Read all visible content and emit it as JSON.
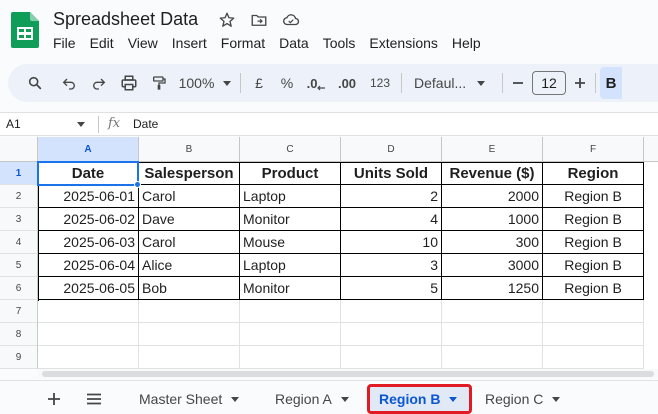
{
  "app": {
    "title": "Spreadsheet Data",
    "menu": [
      "File",
      "Edit",
      "View",
      "Insert",
      "Format",
      "Data",
      "Tools",
      "Extensions",
      "Help"
    ]
  },
  "toolbar": {
    "zoom": "100%",
    "currency": "£",
    "percent": "%",
    "dec_decrease": ".0",
    "dec_increase": ".00",
    "number_format": "123",
    "font": "Defaul...",
    "font_size": "12",
    "bold": "B"
  },
  "formula_bar": {
    "cell_ref": "A1",
    "fx": "fx",
    "value": "Date"
  },
  "grid": {
    "columns": [
      "A",
      "B",
      "C",
      "D",
      "E",
      "F"
    ],
    "rows": [
      "1",
      "2",
      "3",
      "4",
      "5",
      "6",
      "7",
      "8",
      "9"
    ],
    "headers": [
      "Date",
      "Salesperson",
      "Product",
      "Units Sold",
      "Revenue ($)",
      "Region"
    ],
    "data": [
      [
        "2025-06-01",
        "Carol",
        "Laptop",
        "2",
        "2000",
        "Region B"
      ],
      [
        "2025-06-02",
        "Dave",
        "Monitor",
        "4",
        "1000",
        "Region B"
      ],
      [
        "2025-06-03",
        "Carol",
        "Mouse",
        "10",
        "300",
        "Region B"
      ],
      [
        "2025-06-04",
        "Alice",
        "Laptop",
        "3",
        "3000",
        "Region B"
      ],
      [
        "2025-06-05",
        "Bob",
        "Monitor",
        "5",
        "1250",
        "Region B"
      ]
    ]
  },
  "sheet_tabs": {
    "tabs": [
      "Master Sheet",
      "Region A",
      "Region B",
      "Region C"
    ],
    "active": "Region B"
  },
  "colors": {
    "accent": "#0b57d0",
    "selection": "#1a73e8",
    "highlight_box": "#e01b24",
    "logo_green": "#0f9d58"
  }
}
